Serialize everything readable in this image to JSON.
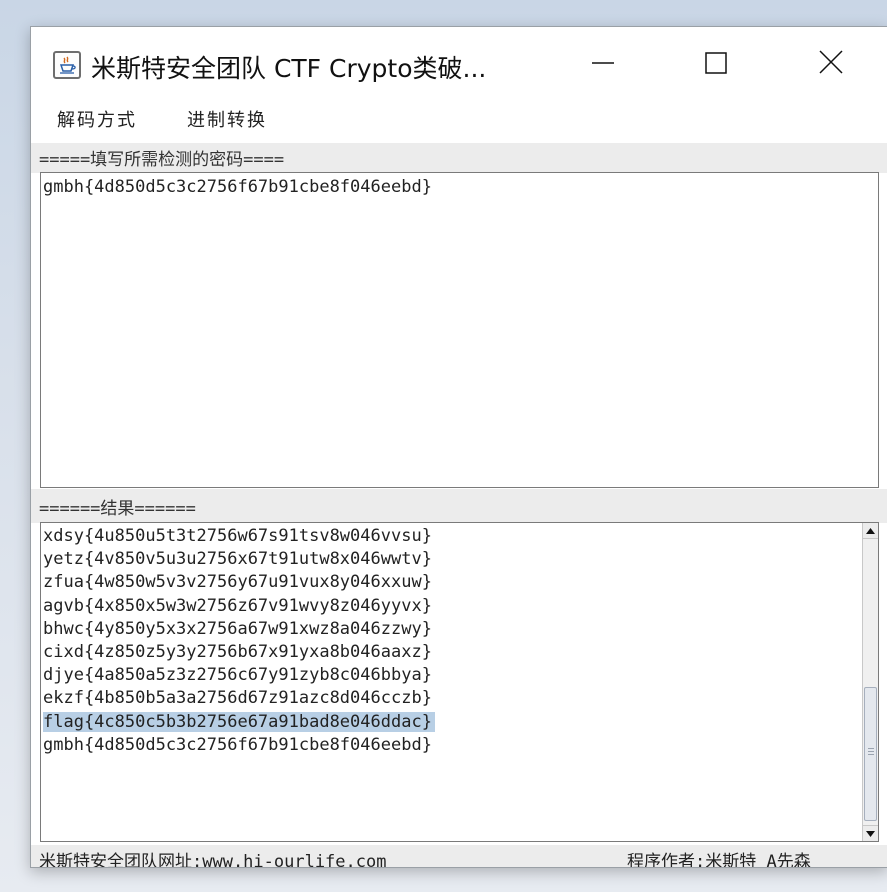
{
  "window": {
    "title": "米斯特安全团队 CTF Crypto类破..."
  },
  "menu": {
    "items": [
      {
        "label": "解码方式"
      },
      {
        "label": "进制转换"
      }
    ]
  },
  "input_section": {
    "header": "=====填写所需检测的密码====",
    "value": "gmbh{4d850d5c3c2756f67b91cbe8f046eebd}"
  },
  "result_section": {
    "header": "======结果======",
    "lines": [
      "xdsy{4u850u5t3t2756w67s91tsv8w046vvsu}",
      "yetz{4v850v5u3u2756x67t91utw8x046wwtv}",
      "zfua{4w850w5v3v2756y67u91vux8y046xxuw}",
      "agvb{4x850x5w3w2756z67v91wvy8z046yyvx}",
      "bhwc{4y850y5x3x2756a67w91xwz8a046zzwy}",
      "cixd{4z850z5y3y2756b67x91yxa8b046aaxz}",
      "djye{4a850a5z3z2756c67y91zyb8c046bbya}",
      "ekzf{4b850b5a3a2756d67z91azc8d046cczb}",
      "flag{4c850c5b3b2756e67a91bad8e046ddac}",
      "gmbh{4d850d5c3c2756f67b91cbe8f046eebd}"
    ],
    "selected_index": 8
  },
  "status": {
    "left": "米斯特安全团队网址:www.hi-ourlife.com",
    "right": "程序作者:米斯特 A先森"
  },
  "colors": {
    "selection": "#b8cfe5",
    "panel": "#ececec"
  }
}
